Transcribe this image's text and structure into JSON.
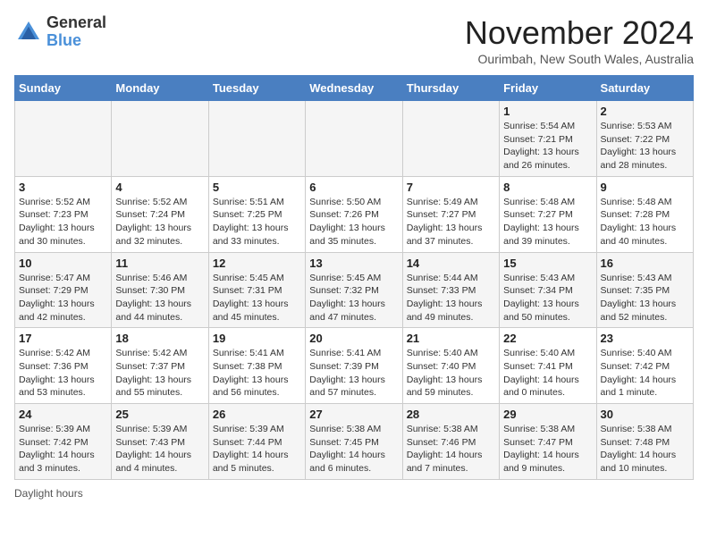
{
  "header": {
    "logo_general": "General",
    "logo_blue": "Blue",
    "month_title": "November 2024",
    "subtitle": "Ourimbah, New South Wales, Australia"
  },
  "days_of_week": [
    "Sunday",
    "Monday",
    "Tuesday",
    "Wednesday",
    "Thursday",
    "Friday",
    "Saturday"
  ],
  "weeks": [
    [
      {
        "day": "",
        "info": ""
      },
      {
        "day": "",
        "info": ""
      },
      {
        "day": "",
        "info": ""
      },
      {
        "day": "",
        "info": ""
      },
      {
        "day": "",
        "info": ""
      },
      {
        "day": "1",
        "info": "Sunrise: 5:54 AM\nSunset: 7:21 PM\nDaylight: 13 hours and 26 minutes."
      },
      {
        "day": "2",
        "info": "Sunrise: 5:53 AM\nSunset: 7:22 PM\nDaylight: 13 hours and 28 minutes."
      }
    ],
    [
      {
        "day": "3",
        "info": "Sunrise: 5:52 AM\nSunset: 7:23 PM\nDaylight: 13 hours and 30 minutes."
      },
      {
        "day": "4",
        "info": "Sunrise: 5:52 AM\nSunset: 7:24 PM\nDaylight: 13 hours and 32 minutes."
      },
      {
        "day": "5",
        "info": "Sunrise: 5:51 AM\nSunset: 7:25 PM\nDaylight: 13 hours and 33 minutes."
      },
      {
        "day": "6",
        "info": "Sunrise: 5:50 AM\nSunset: 7:26 PM\nDaylight: 13 hours and 35 minutes."
      },
      {
        "day": "7",
        "info": "Sunrise: 5:49 AM\nSunset: 7:27 PM\nDaylight: 13 hours and 37 minutes."
      },
      {
        "day": "8",
        "info": "Sunrise: 5:48 AM\nSunset: 7:27 PM\nDaylight: 13 hours and 39 minutes."
      },
      {
        "day": "9",
        "info": "Sunrise: 5:48 AM\nSunset: 7:28 PM\nDaylight: 13 hours and 40 minutes."
      }
    ],
    [
      {
        "day": "10",
        "info": "Sunrise: 5:47 AM\nSunset: 7:29 PM\nDaylight: 13 hours and 42 minutes."
      },
      {
        "day": "11",
        "info": "Sunrise: 5:46 AM\nSunset: 7:30 PM\nDaylight: 13 hours and 44 minutes."
      },
      {
        "day": "12",
        "info": "Sunrise: 5:45 AM\nSunset: 7:31 PM\nDaylight: 13 hours and 45 minutes."
      },
      {
        "day": "13",
        "info": "Sunrise: 5:45 AM\nSunset: 7:32 PM\nDaylight: 13 hours and 47 minutes."
      },
      {
        "day": "14",
        "info": "Sunrise: 5:44 AM\nSunset: 7:33 PM\nDaylight: 13 hours and 49 minutes."
      },
      {
        "day": "15",
        "info": "Sunrise: 5:43 AM\nSunset: 7:34 PM\nDaylight: 13 hours and 50 minutes."
      },
      {
        "day": "16",
        "info": "Sunrise: 5:43 AM\nSunset: 7:35 PM\nDaylight: 13 hours and 52 minutes."
      }
    ],
    [
      {
        "day": "17",
        "info": "Sunrise: 5:42 AM\nSunset: 7:36 PM\nDaylight: 13 hours and 53 minutes."
      },
      {
        "day": "18",
        "info": "Sunrise: 5:42 AM\nSunset: 7:37 PM\nDaylight: 13 hours and 55 minutes."
      },
      {
        "day": "19",
        "info": "Sunrise: 5:41 AM\nSunset: 7:38 PM\nDaylight: 13 hours and 56 minutes."
      },
      {
        "day": "20",
        "info": "Sunrise: 5:41 AM\nSunset: 7:39 PM\nDaylight: 13 hours and 57 minutes."
      },
      {
        "day": "21",
        "info": "Sunrise: 5:40 AM\nSunset: 7:40 PM\nDaylight: 13 hours and 59 minutes."
      },
      {
        "day": "22",
        "info": "Sunrise: 5:40 AM\nSunset: 7:41 PM\nDaylight: 14 hours and 0 minutes."
      },
      {
        "day": "23",
        "info": "Sunrise: 5:40 AM\nSunset: 7:42 PM\nDaylight: 14 hours and 1 minute."
      }
    ],
    [
      {
        "day": "24",
        "info": "Sunrise: 5:39 AM\nSunset: 7:42 PM\nDaylight: 14 hours and 3 minutes."
      },
      {
        "day": "25",
        "info": "Sunrise: 5:39 AM\nSunset: 7:43 PM\nDaylight: 14 hours and 4 minutes."
      },
      {
        "day": "26",
        "info": "Sunrise: 5:39 AM\nSunset: 7:44 PM\nDaylight: 14 hours and 5 minutes."
      },
      {
        "day": "27",
        "info": "Sunrise: 5:38 AM\nSunset: 7:45 PM\nDaylight: 14 hours and 6 minutes."
      },
      {
        "day": "28",
        "info": "Sunrise: 5:38 AM\nSunset: 7:46 PM\nDaylight: 14 hours and 7 minutes."
      },
      {
        "day": "29",
        "info": "Sunrise: 5:38 AM\nSunset: 7:47 PM\nDaylight: 14 hours and 9 minutes."
      },
      {
        "day": "30",
        "info": "Sunrise: 5:38 AM\nSunset: 7:48 PM\nDaylight: 14 hours and 10 minutes."
      }
    ]
  ],
  "footer": {
    "daylight_hours": "Daylight hours"
  }
}
